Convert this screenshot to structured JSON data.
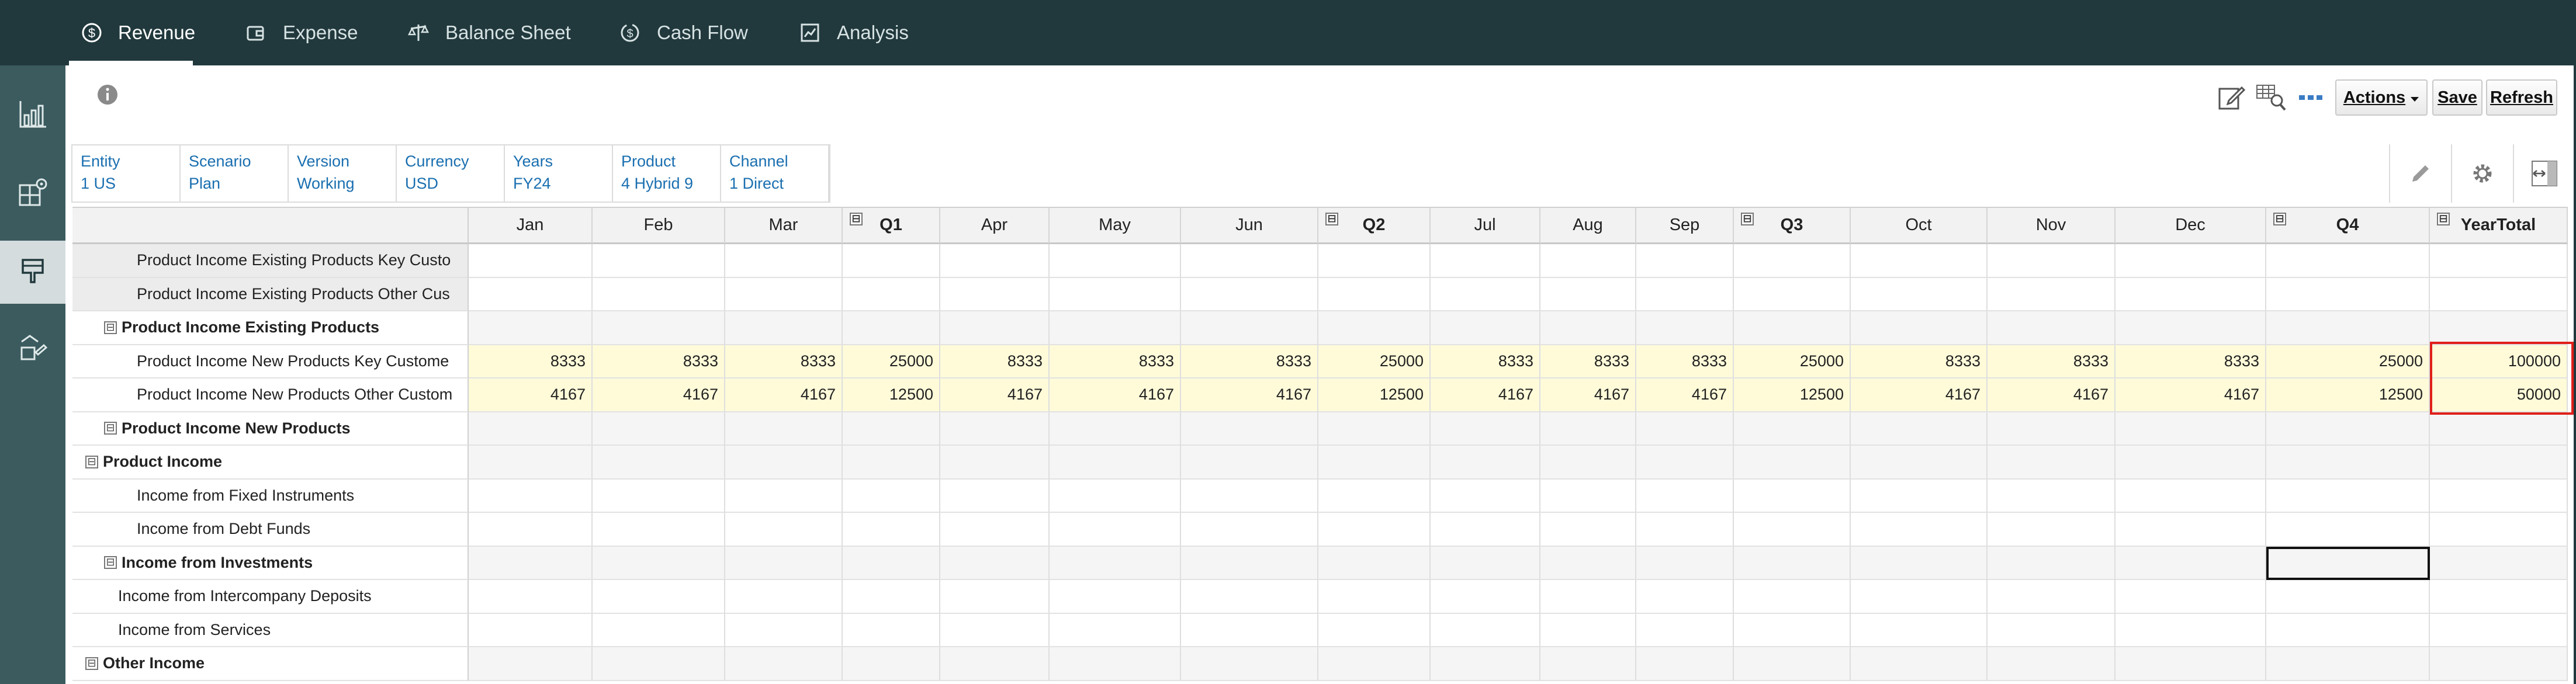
{
  "nav": {
    "tabs": [
      {
        "label": "Revenue",
        "icon": "dollar-circle-icon",
        "active": true
      },
      {
        "label": "Expense",
        "icon": "wallet-icon"
      },
      {
        "label": "Balance Sheet",
        "icon": "scale-icon"
      },
      {
        "label": "Cash Flow",
        "icon": "cash-flow-icon"
      },
      {
        "label": "Analysis",
        "icon": "analysis-icon"
      }
    ]
  },
  "sidebar": {
    "items": [
      {
        "icon": "bar-chart-icon"
      },
      {
        "icon": "grid-settings-icon"
      },
      {
        "icon": "form-icon",
        "active": true
      },
      {
        "icon": "rule-icon"
      }
    ]
  },
  "toolbar": {
    "info_icon": "info-icon",
    "actions_label": "Actions",
    "save_label": "Save",
    "refresh_label": "Refresh"
  },
  "pov": [
    {
      "dimension": "Entity",
      "member": "1 US"
    },
    {
      "dimension": "Scenario",
      "member": "Plan"
    },
    {
      "dimension": "Version",
      "member": "Working"
    },
    {
      "dimension": "Currency",
      "member": "USD"
    },
    {
      "dimension": "Years",
      "member": "FY24"
    },
    {
      "dimension": "Product",
      "member": "4 Hybrid 9"
    },
    {
      "dimension": "Channel",
      "member": "1 Direct"
    }
  ],
  "grid": {
    "columns": [
      "Jan",
      "Feb",
      "Mar",
      "Q1",
      "Apr",
      "May",
      "Jun",
      "Q2",
      "Jul",
      "Aug",
      "Sep",
      "Q3",
      "Oct",
      "Nov",
      "Dec",
      "Q4",
      "YearTotal"
    ],
    "rows": [
      {
        "label": "Product Income Existing Products Key Custo",
        "values": []
      },
      {
        "label": "Product Income Existing Products Other Cus",
        "values": []
      },
      {
        "label": "Product Income Existing Products",
        "values": []
      },
      {
        "label": "Product Income New Products Key Custome",
        "values": [
          "8333",
          "8333",
          "8333",
          "25000",
          "8333",
          "8333",
          "8333",
          "25000",
          "8333",
          "8333",
          "8333",
          "25000",
          "8333",
          "8333",
          "8333",
          "25000",
          "100000"
        ]
      },
      {
        "label": "Product Income New Products Other Custom",
        "values": [
          "4167",
          "4167",
          "4167",
          "12500",
          "4167",
          "4167",
          "4167",
          "12500",
          "4167",
          "4167",
          "4167",
          "12500",
          "4167",
          "4167",
          "4167",
          "12500",
          "50000"
        ]
      },
      {
        "label": "Product Income New Products",
        "values": []
      },
      {
        "label": "Product Income",
        "values": []
      },
      {
        "label": "Income from Fixed Instruments",
        "values": []
      },
      {
        "label": "Income from Debt Funds",
        "values": []
      },
      {
        "label": "Income from Investments",
        "values": []
      },
      {
        "label": "Income from Intercompany Deposits",
        "values": []
      },
      {
        "label": "Income from Services",
        "values": []
      },
      {
        "label": "Other Income",
        "values": []
      }
    ],
    "collapse_glyph": "⊟"
  }
}
